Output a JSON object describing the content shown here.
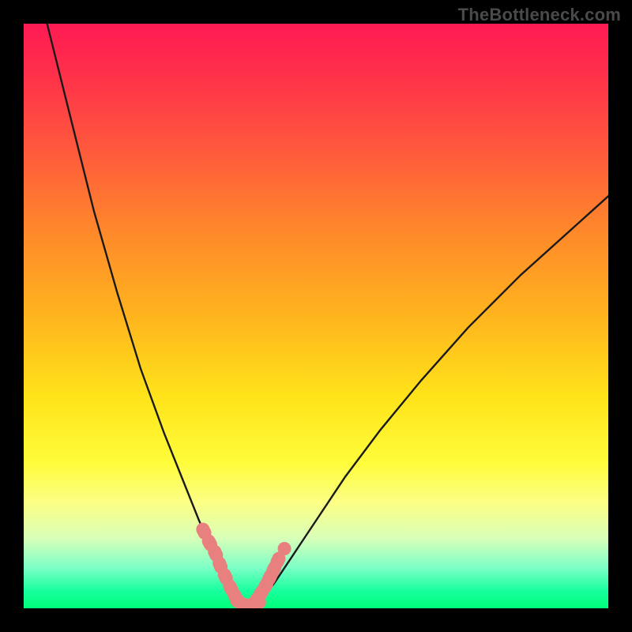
{
  "attribution": "TheBottleneck.com",
  "colors": {
    "gradient_top": "#ff1b54",
    "gradient_mid": "#ffe41a",
    "gradient_bottom": "#00ff7a",
    "curve": "#1a1a1a",
    "marker": "#e98080",
    "frame": "#000000"
  },
  "chart_data": {
    "type": "line",
    "title": "",
    "xlabel": "",
    "ylabel": "",
    "xlim": [
      0,
      100
    ],
    "ylim": [
      0,
      100
    ],
    "grid": false,
    "legend": false,
    "description": "Two black curves descending from the top into a V-shaped minimum near the bottom center-left, over a vertical heat gradient (red→yellow→green). Salmon-colored marker segments highlight the region near the minimum on both curves.",
    "series": [
      {
        "name": "left-curve",
        "x": [
          4,
          8,
          12,
          16,
          20,
          24,
          28,
          30,
          32,
          33.5,
          35,
          36.8
        ],
        "y": [
          100,
          84,
          68,
          54,
          41,
          30,
          20,
          15,
          10.5,
          6.5,
          3.5,
          1.2
        ]
      },
      {
        "name": "right-curve",
        "x": [
          41,
          43,
          46,
          50,
          55,
          61,
          68,
          76,
          85,
          95,
          100
        ],
        "y": [
          1.8,
          4.5,
          9,
          15,
          22.5,
          30.5,
          39,
          48,
          57,
          66,
          70.5
        ]
      },
      {
        "name": "floor-segment",
        "x": [
          36.8,
          38,
          39.2,
          40.2,
          41
        ],
        "y": [
          1.2,
          0.6,
          0.45,
          0.6,
          1.8
        ]
      }
    ],
    "markers": {
      "left_band": {
        "x": [
          30.8,
          31.8,
          32.8,
          33.6,
          34.5,
          35.4,
          36.2
        ],
        "y": [
          13.2,
          11.2,
          9.4,
          7.4,
          5.4,
          3.5,
          2.0
        ]
      },
      "right_band": {
        "x": [
          39.8,
          40.6,
          41.4,
          42.1,
          42.8,
          43.5
        ],
        "y": [
          1.4,
          2.6,
          3.9,
          5.3,
          6.7,
          8.2
        ]
      },
      "dot_above_right": {
        "x": 44.6,
        "y": 10.2
      },
      "floor_band": {
        "x": [
          36.8,
          37.6,
          38.4,
          39.2,
          40.0
        ],
        "y": [
          1.1,
          0.65,
          0.5,
          0.55,
          0.9
        ]
      }
    }
  }
}
